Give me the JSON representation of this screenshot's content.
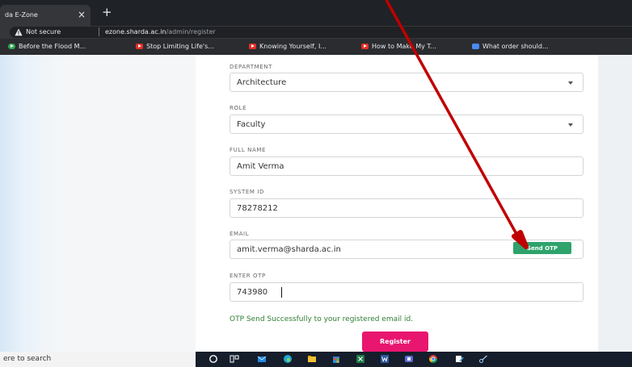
{
  "browser": {
    "tab_title": "da E-Zone",
    "tab_close_glyph": "×",
    "new_tab_glyph": "+",
    "security_label": "Not secure",
    "url_host": "ezone.sharda.ac.in",
    "url_path": "/admin/register"
  },
  "bookmarks": [
    {
      "label": "Before the Flood M...",
      "icon": "green-play-icon",
      "color": "#34a853"
    },
    {
      "label": "Stop Limiting Life's...",
      "icon": "youtube-icon",
      "color": "#e52d27"
    },
    {
      "label": "Knowing Yourself, I...",
      "icon": "youtube-icon",
      "color": "#e52d27"
    },
    {
      "label": "How to Make My T...",
      "icon": "youtube-icon",
      "color": "#e52d27"
    },
    {
      "label": "What order should...",
      "icon": "bookmark-icon",
      "color": "#4a8af4"
    }
  ],
  "form": {
    "department": {
      "label": "DEPARTMENT",
      "value": "Architecture"
    },
    "role": {
      "label": "ROLE",
      "value": "Faculty"
    },
    "full_name": {
      "label": "FULL NAME",
      "value": "Amit Verma"
    },
    "system_id": {
      "label": "SYSTEM ID",
      "value": "78278212"
    },
    "email": {
      "label": "EMAIL",
      "value": "amit.verma@sharda.ac.in",
      "send_otp_label": "Send OTP"
    },
    "otp": {
      "label": "ENTER OTP",
      "value": "743980"
    },
    "success_message": "OTP Send Successfully to your registered email id.",
    "register_label": "Register"
  },
  "taskbar": {
    "search_text": "ere to search",
    "icons": [
      "start-circle-icon",
      "task-view-icon",
      "mail-icon",
      "edge-icon",
      "file-explorer-icon",
      "store-icon",
      "excel-icon",
      "word-icon",
      "teams-icon",
      "chrome-icon",
      "paint-icon",
      "snip-icon"
    ]
  },
  "colors": {
    "accent_green": "#2ea36b",
    "register_pink": "#e8166f",
    "annotation_arrow": "#c00000"
  }
}
